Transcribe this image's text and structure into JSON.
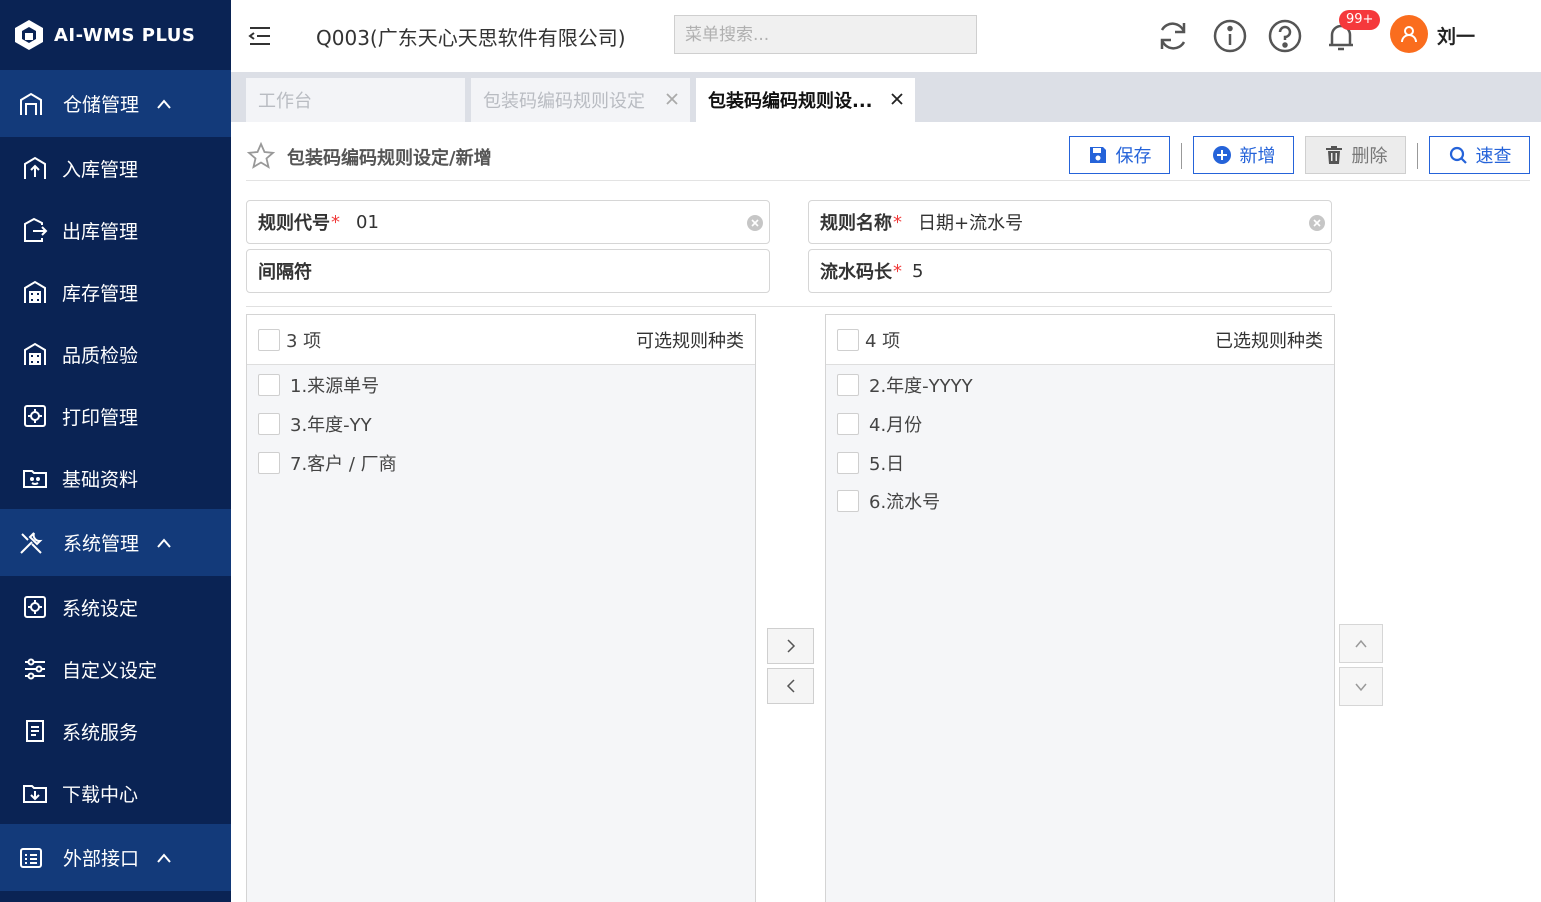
{
  "app": {
    "logo_text": "AI-WMS PLUS"
  },
  "sidebar": {
    "items": [
      {
        "label": "仓储管理",
        "type": "group",
        "icon": "warehouse-icon"
      },
      {
        "label": "入库管理",
        "type": "item",
        "icon": "inbound-icon"
      },
      {
        "label": "出库管理",
        "type": "item",
        "icon": "outbound-icon"
      },
      {
        "label": "库存管理",
        "type": "item",
        "icon": "inventory-icon"
      },
      {
        "label": "品质检验",
        "type": "item",
        "icon": "quality-icon"
      },
      {
        "label": "打印管理",
        "type": "item",
        "icon": "print-icon"
      },
      {
        "label": "基础资料",
        "type": "item",
        "icon": "basic-data-icon"
      },
      {
        "label": "系统管理",
        "type": "group",
        "icon": "tools-icon"
      },
      {
        "label": "系统设定",
        "type": "item",
        "icon": "settings-icon"
      },
      {
        "label": "自定义设定",
        "type": "item",
        "icon": "sliders-icon"
      },
      {
        "label": "系统服务",
        "type": "item",
        "icon": "service-icon"
      },
      {
        "label": "下载中心",
        "type": "item",
        "icon": "download-icon"
      },
      {
        "label": "外部接口",
        "type": "group",
        "icon": "interface-icon"
      }
    ]
  },
  "header": {
    "company": "Q003(广东天心天思软件有限公司)",
    "search_placeholder": "菜单搜索...",
    "notification_badge": "99+",
    "username": "刘一"
  },
  "tabs": [
    {
      "label": "工作台",
      "active": false,
      "closable": false
    },
    {
      "label": "包装码编码规则设定",
      "active": false,
      "closable": true
    },
    {
      "label": "包装码编码规则设...",
      "active": true,
      "closable": true
    }
  ],
  "page": {
    "title": "包装码编码规则设定/新增",
    "buttons": {
      "save": "保存",
      "add": "新增",
      "delete": "删除",
      "query": "速查"
    }
  },
  "form": {
    "rule_code": {
      "label": "规则代号",
      "value": "01",
      "required": true
    },
    "rule_name": {
      "label": "规则名称",
      "value": "日期+流水号",
      "required": true
    },
    "separator": {
      "label": "间隔符",
      "value": "",
      "required": false
    },
    "serial_length": {
      "label": "流水码长",
      "value": "5",
      "required": true
    }
  },
  "transfer": {
    "left": {
      "count": "3 项",
      "title": "可选规则种类",
      "items": [
        "1.来源单号",
        "3.年度-YY",
        "7.客户 / 厂商"
      ]
    },
    "right": {
      "count": "4 项",
      "title": "已选规则种类",
      "items": [
        "2.年度-YYYY",
        "4.月份",
        "5.日",
        "6.流水号"
      ]
    }
  },
  "colors": {
    "sidebar_bg": "#0a2354",
    "sidebar_group_bg": "#133a7a",
    "primary": "#2563d9",
    "badge": "#f5393c",
    "avatar": "#fa6d1e"
  }
}
